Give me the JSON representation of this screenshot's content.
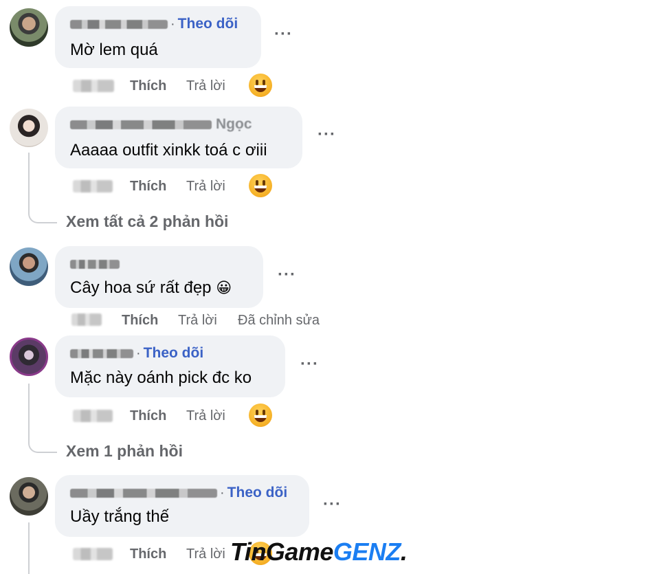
{
  "comments": [
    {
      "name_visible": "",
      "follow": "Theo dõi",
      "text": "Mờ lem quá",
      "like": "Thích",
      "reply": "Trả lời",
      "reaction": "grinning-face-icon",
      "more": "···"
    },
    {
      "name_visible": "Ngọc",
      "follow": "",
      "text": "Aaaaa outfit xinkk toá c ơiii",
      "like": "Thích",
      "reply": "Trả lời",
      "reaction": "grinning-face-icon",
      "more": "···",
      "replies_link": "Xem tất cả 2 phản hồi"
    },
    {
      "name_visible": "",
      "follow": "",
      "text": "Cây hoa sứ rất đẹp",
      "text_emoji": "😀",
      "like": "Thích",
      "reply": "Trả lời",
      "edited": "Đã chỉnh sửa",
      "more": "···"
    },
    {
      "name_visible": "",
      "follow": "Theo dõi",
      "text": "Mặc này oánh pick đc ko",
      "like": "Thích",
      "reply": "Trả lời",
      "reaction": "grinning-face-icon",
      "more": "···",
      "replies_link": "Xem 1 phản hồi"
    },
    {
      "name_visible": "",
      "follow": "Theo dõi",
      "text": "Uầy trắng thế",
      "like": "Thích",
      "reply": "Trả lời",
      "reaction": "grinning-face-icon",
      "more": "···"
    }
  ],
  "watermark": {
    "part1": "TinGame",
    "part2": "GENZ",
    "suffix": "."
  },
  "colors": {
    "bubble": "#f0f2f5",
    "follow": "#3b62c6",
    "muted": "#65676b",
    "thread": "#ced0d4"
  }
}
